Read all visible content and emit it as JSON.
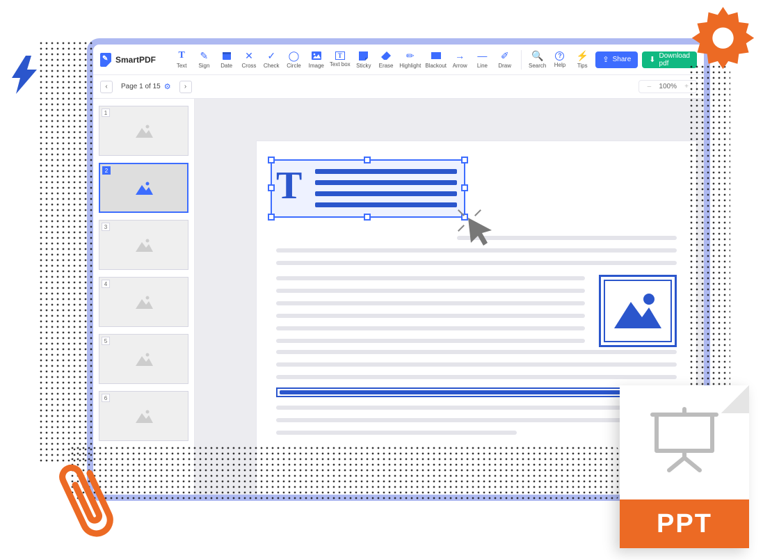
{
  "brand": "SmartPDF",
  "colors": {
    "accent": "#3D6DFF",
    "success": "#10B981",
    "orange": "#EC6A24"
  },
  "toolbar": {
    "tools": [
      {
        "id": "text",
        "label": "Text",
        "icon": "T"
      },
      {
        "id": "sign",
        "label": "Sign",
        "icon": "✎"
      },
      {
        "id": "date",
        "label": "Date",
        "icon": "📅"
      },
      {
        "id": "cross",
        "label": "Cross",
        "icon": "✕"
      },
      {
        "id": "check",
        "label": "Check",
        "icon": "✓"
      },
      {
        "id": "circle",
        "label": "Circle",
        "icon": "◯"
      },
      {
        "id": "image",
        "label": "Image",
        "icon": "🖼"
      },
      {
        "id": "textbox",
        "label": "Text box",
        "icon": "𝐓"
      },
      {
        "id": "sticky",
        "label": "Sticky",
        "icon": "▤"
      },
      {
        "id": "erase",
        "label": "Erase",
        "icon": "◆"
      },
      {
        "id": "highlight",
        "label": "Highlight",
        "icon": "✏"
      },
      {
        "id": "blackout",
        "label": "Blackout",
        "icon": "▆"
      },
      {
        "id": "arrow",
        "label": "Arrow",
        "icon": "→"
      },
      {
        "id": "line",
        "label": "Line",
        "icon": "—"
      },
      {
        "id": "draw",
        "label": "Draw",
        "icon": "✐"
      }
    ],
    "util": [
      {
        "id": "search",
        "label": "Search",
        "icon": "🔍"
      },
      {
        "id": "help",
        "label": "Help",
        "icon": "?"
      },
      {
        "id": "tips",
        "label": "Tips",
        "icon": "⚡"
      }
    ],
    "share": "Share",
    "download": "Download pdf"
  },
  "pager": {
    "prev": "‹",
    "label": "Page 1 of 15",
    "next": "›"
  },
  "zoom": {
    "minus": "–",
    "value": "100%",
    "plus": "+"
  },
  "thumbnails": {
    "count": 6,
    "active": 2,
    "numbers": [
      "1",
      "2",
      "3",
      "4",
      "5",
      "6"
    ]
  },
  "ppt": {
    "label": "PPT"
  }
}
